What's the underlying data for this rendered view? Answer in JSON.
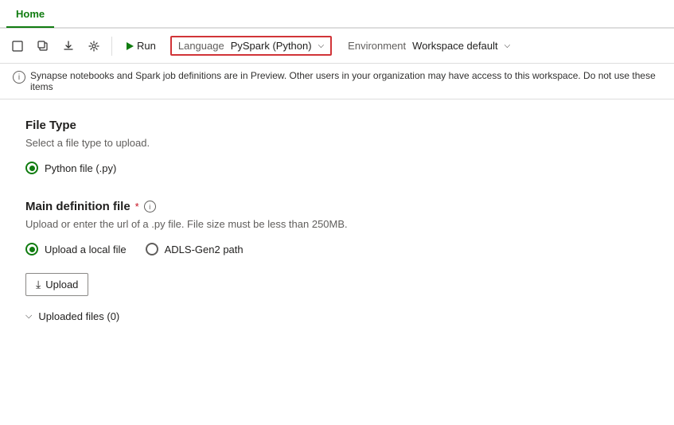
{
  "tab": {
    "label": "Home"
  },
  "toolbar": {
    "icons": [
      "new-item-icon",
      "copy-icon",
      "export-icon",
      "settings-icon"
    ],
    "run_label": "Run",
    "language_label": "Language",
    "language_value": "PySpark (Python)",
    "environment_label": "Environment",
    "environment_value": "Workspace default"
  },
  "info_banner": {
    "text": "Synapse notebooks and Spark job definitions are in Preview. Other users in your organization may have access to this workspace. Do not use these items"
  },
  "file_type": {
    "section_title": "File Type",
    "section_desc": "Select a file type to upload.",
    "option_label": "Python file (.py)"
  },
  "main_definition": {
    "section_title": "Main definition file",
    "required_indicator": "*",
    "section_desc": "Upload or enter the url of a .py file. File size must be less than 250MB.",
    "upload_local_label": "Upload a local file",
    "adls_label": "ADLS-Gen2 path",
    "upload_button_label": "Upload"
  },
  "uploaded_files": {
    "label": "Uploaded files",
    "count": "(0)"
  }
}
